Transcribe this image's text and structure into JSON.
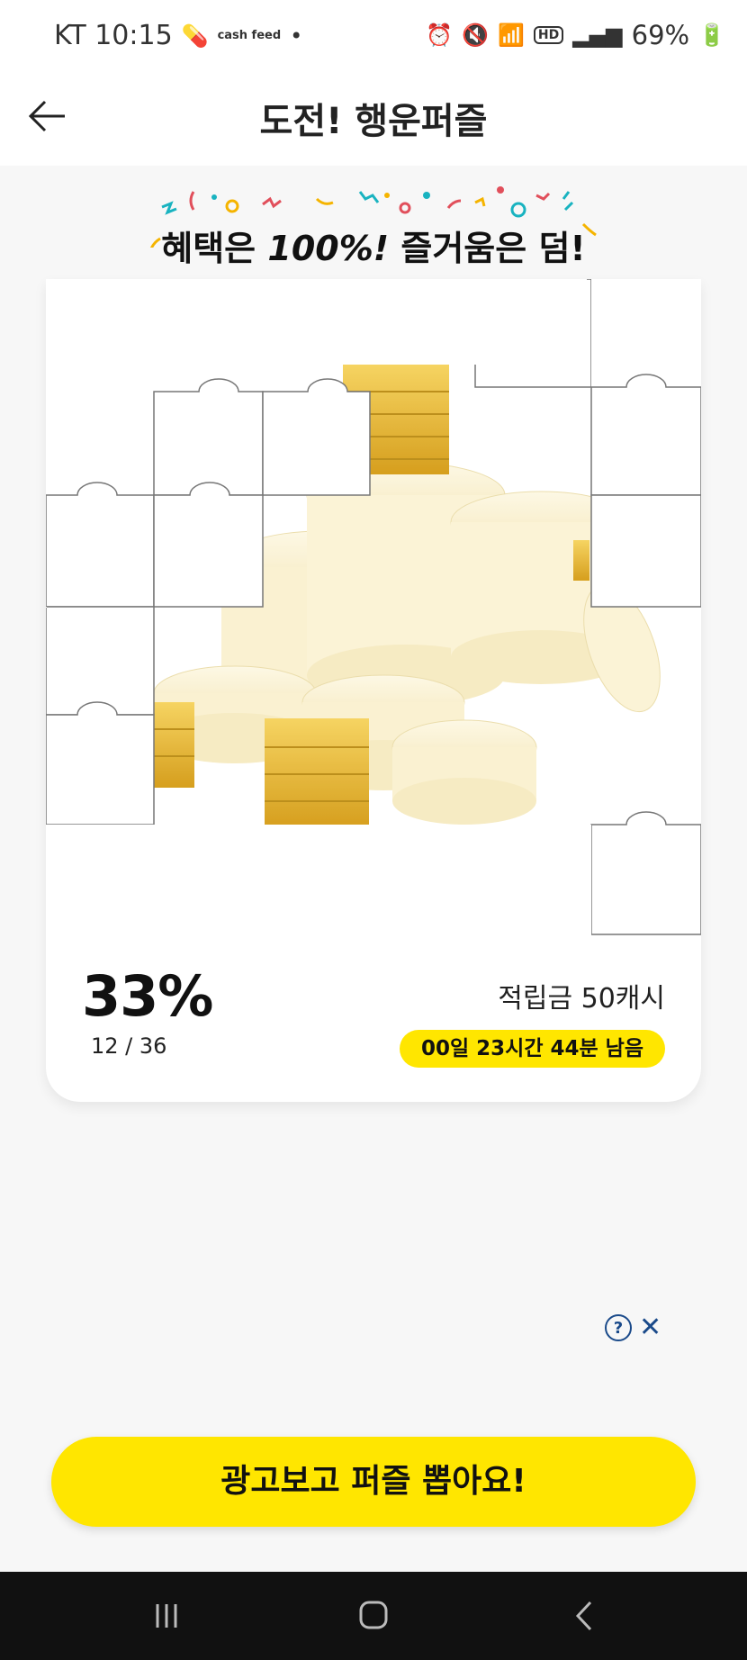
{
  "status_bar": {
    "carrier_time": "KT 10:15",
    "cashfeed_label": "cash feed",
    "battery": "69%",
    "icons": [
      "pill-icon",
      "cashfeed-icon",
      "dot-icon",
      "alarm-icon",
      "mute-icon",
      "wifi-icon",
      "hd-icon",
      "signal-icon",
      "battery-icon"
    ]
  },
  "header": {
    "title": "도전! 행운퍼즐",
    "back_icon": "arrow-left-icon"
  },
  "banner": {
    "text_1": "혜택은 ",
    "text_2": "100%!",
    "text_3": " 즐거움은 ",
    "text_4": "덤!"
  },
  "card": {
    "percent": "33%",
    "progress": "12 / 36",
    "reward": "적립금 50캐시",
    "timer": "00일 23시간 44분 남음"
  },
  "ad": {
    "help_icon": "help-icon",
    "close_icon": "close-icon"
  },
  "cta": {
    "label": "광고보고 퍼즐 뽑아요!"
  },
  "nav": {
    "recent_icon": "recents-icon",
    "home_icon": "home-icon",
    "back_icon": "back-icon"
  },
  "colors": {
    "accent": "#ffe600",
    "ad_blue": "#1a4a8a",
    "coin_gold": "#e8b82a",
    "coin_faded": "#fbf3d0"
  }
}
